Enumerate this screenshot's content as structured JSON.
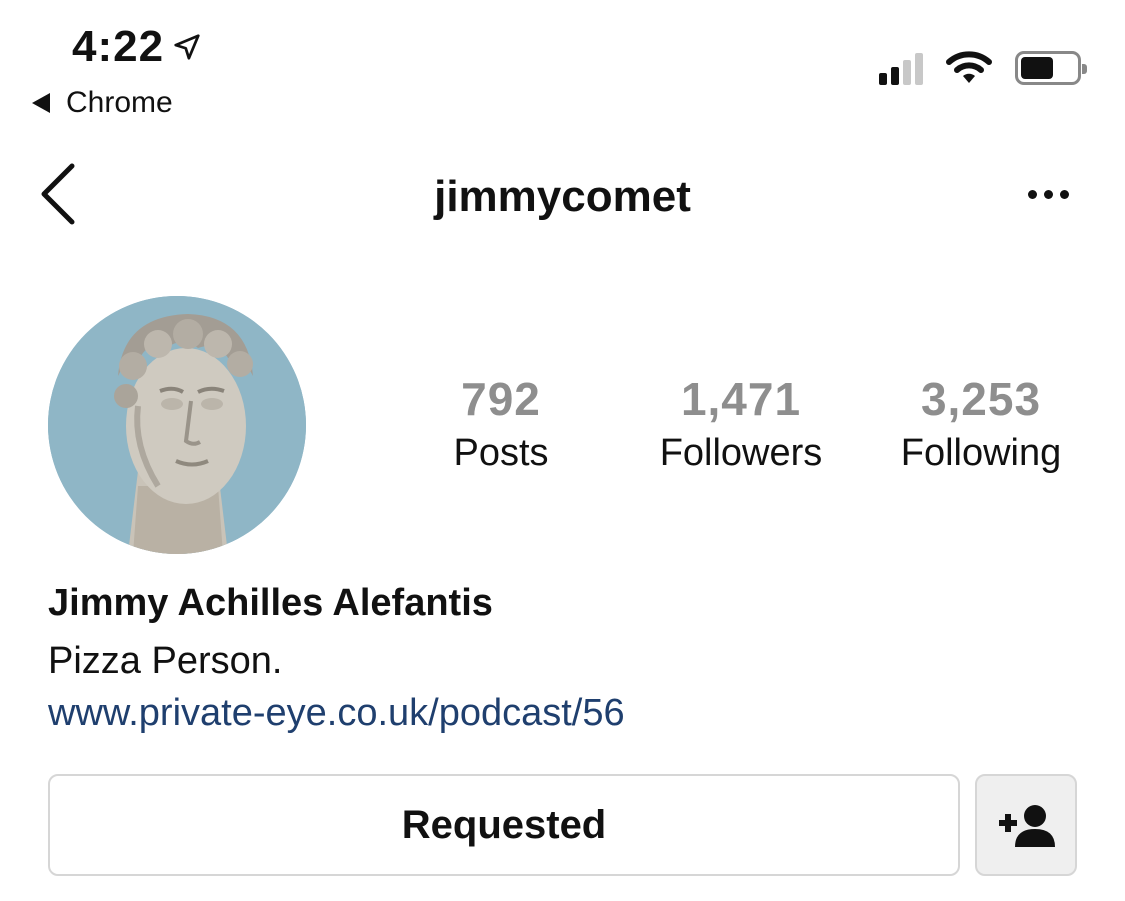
{
  "status_bar": {
    "time": "4:22",
    "back_app": "Chrome",
    "icons": [
      "location-arrow-icon",
      "cellular-signal-icon",
      "wifi-icon",
      "battery-icon"
    ]
  },
  "header": {
    "username": "jimmycomet",
    "icons": [
      "back-chevron-icon",
      "more-options-icon"
    ]
  },
  "profile": {
    "avatar": "profile-photo",
    "stats": [
      {
        "value": "792",
        "label": "Posts"
      },
      {
        "value": "1,471",
        "label": "Followers"
      },
      {
        "value": "3,253",
        "label": "Following"
      }
    ],
    "full_name": "Jimmy Achilles Alefantis",
    "bio": "Pizza Person.",
    "link": "www.private-eye.co.uk/podcast/56"
  },
  "actions": {
    "requested_label": "Requested",
    "add_user_icon": "add-user-icon"
  },
  "colors": {
    "stat_number": "#8e8e8e",
    "link": "#1f3f6e",
    "button_border": "#d6d6d6",
    "icon_button_bg": "#efefef"
  }
}
